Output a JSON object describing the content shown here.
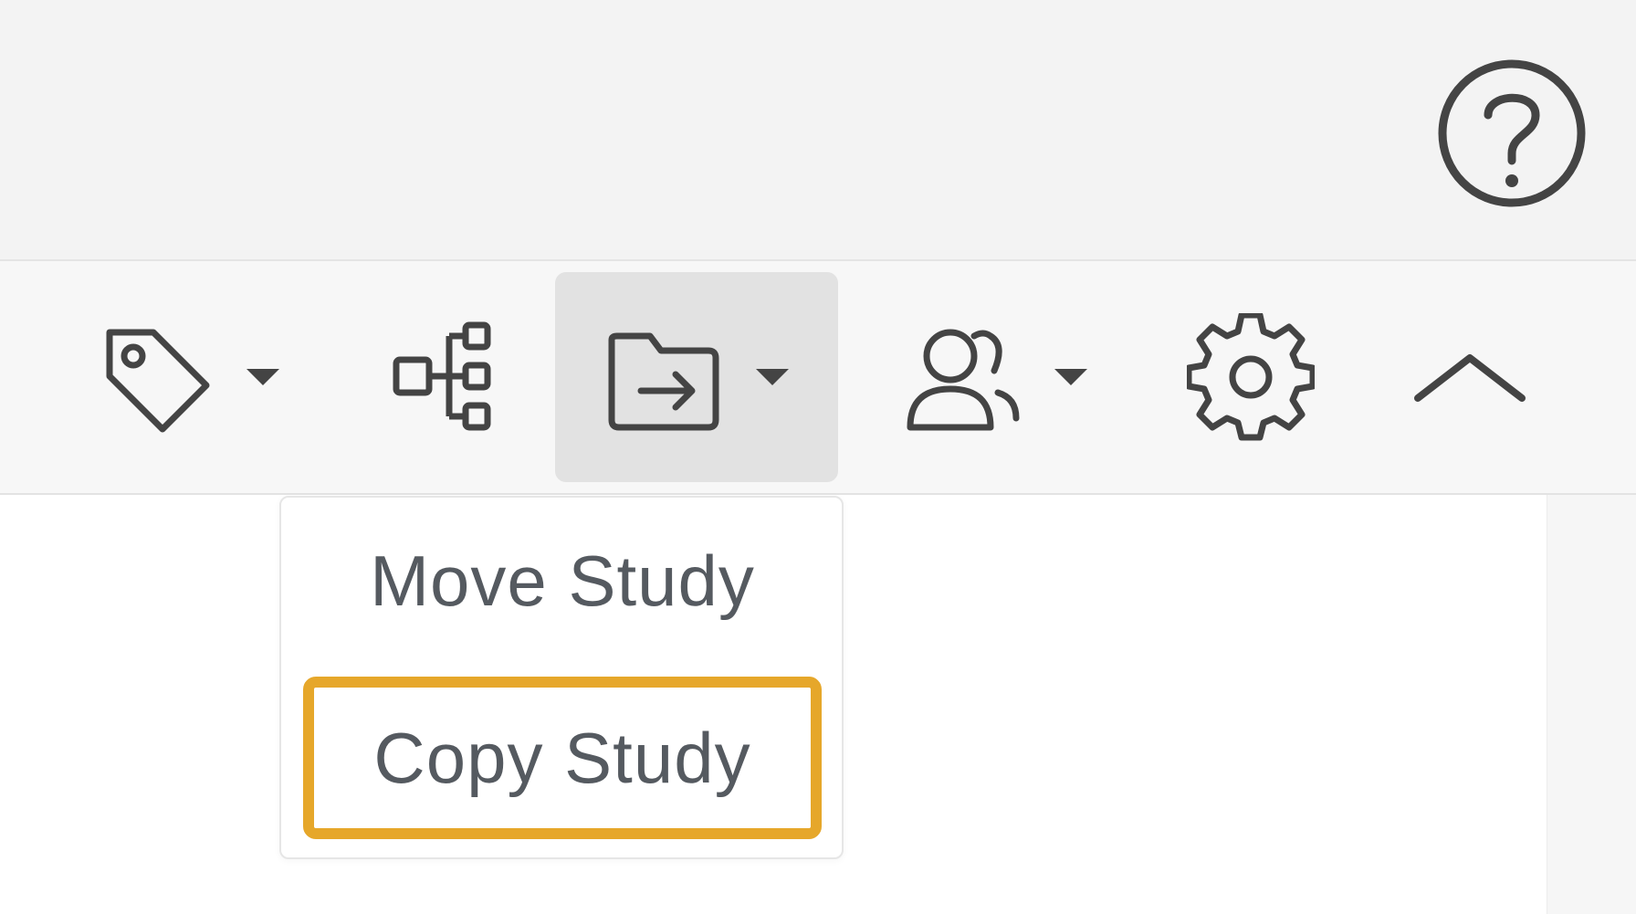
{
  "header": {
    "help_icon": "help-circle-icon"
  },
  "toolbar": {
    "tools": [
      {
        "name": "tag",
        "icon": "tag-icon",
        "has_dropdown": true
      },
      {
        "name": "hierarchy",
        "icon": "hierarchy-icon",
        "has_dropdown": false
      },
      {
        "name": "move-folder",
        "icon": "folder-arrow-icon",
        "has_dropdown": true,
        "active": true
      },
      {
        "name": "users",
        "icon": "users-icon",
        "has_dropdown": true
      },
      {
        "name": "settings",
        "icon": "gear-icon",
        "has_dropdown": false
      },
      {
        "name": "collapse",
        "icon": "chevron-up-icon",
        "has_dropdown": false
      }
    ]
  },
  "dropdown": {
    "items": [
      {
        "label": "Move Study"
      },
      {
        "label": "Copy Study",
        "highlighted": true
      }
    ]
  },
  "colors": {
    "highlight": "#e6a72a",
    "icon": "#444444",
    "menu_text": "#555a60",
    "active_tool_bg": "#e2e2e2"
  }
}
